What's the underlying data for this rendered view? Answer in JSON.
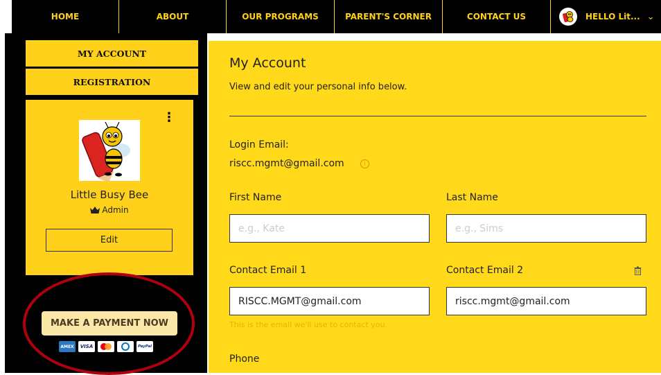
{
  "nav": {
    "items": [
      "HOME",
      "ABOUT",
      "OUR PROGRAMS",
      "PARENT'S CORNER",
      "CONTACT US"
    ],
    "user_greeting": "HELLO Lit..."
  },
  "sidebar": {
    "my_account": "MY ACCOUNT",
    "registration": "REGISTRATION",
    "profile": {
      "name": "Little Busy Bee",
      "role": "Admin",
      "edit_label": "Edit",
      "image_text": "Little Busy Bee"
    },
    "payment": {
      "button_label": "MAKE A PAYMENT NOW",
      "cards": [
        "AMEX",
        "VISA",
        "MC",
        "Diners",
        "PayPal"
      ]
    }
  },
  "main": {
    "title": "My Account",
    "subtitle": "View and edit your personal info below.",
    "login_email_label": "Login Email:",
    "login_email": "riscc.mgmt@gmail.com",
    "first_name_label": "First Name",
    "first_name_placeholder": "e.g., Kate",
    "last_name_label": "Last Name",
    "last_name_placeholder": "e.g., Sims",
    "contact_email1_label": "Contact Email 1",
    "contact_email1_value": "RISCC.MGMT@gmail.com",
    "contact_email2_label": "Contact Email 2",
    "contact_email2_value": "riscc.mgmt@gmail.com",
    "contact_email_hint": "This is the email we'll use to contact you.",
    "phone_label": "Phone"
  },
  "colors": {
    "accent": "#ffd91a",
    "nav_text": "#ffd11a",
    "annotation": "#b0000f",
    "payment_button": "#fbe7a7"
  }
}
